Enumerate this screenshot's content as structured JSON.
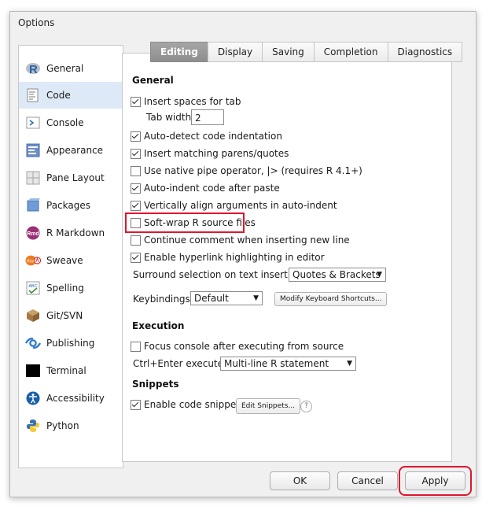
{
  "window": {
    "title": "Options"
  },
  "sidebar": {
    "items": [
      {
        "label": "General",
        "icon": "r-logo-icon"
      },
      {
        "label": "Code",
        "icon": "code-icon"
      },
      {
        "label": "Console",
        "icon": "console-icon"
      },
      {
        "label": "Appearance",
        "icon": "appearance-icon"
      },
      {
        "label": "Pane Layout",
        "icon": "pane-layout-icon"
      },
      {
        "label": "Packages",
        "icon": "packages-icon"
      },
      {
        "label": "R Markdown",
        "icon": "rmarkdown-icon"
      },
      {
        "label": "Sweave",
        "icon": "sweave-icon"
      },
      {
        "label": "Spelling",
        "icon": "spelling-icon"
      },
      {
        "label": "Git/SVN",
        "icon": "git-svn-icon"
      },
      {
        "label": "Publishing",
        "icon": "publishing-icon"
      },
      {
        "label": "Terminal",
        "icon": "terminal-icon"
      },
      {
        "label": "Accessibility",
        "icon": "accessibility-icon"
      },
      {
        "label": "Python",
        "icon": "python-icon"
      }
    ],
    "active": "Code",
    "icon_labels": {
      "rmarkdown": "Rmd",
      "sweave": "Rnw",
      "spelling": "ABC"
    }
  },
  "tabs": [
    "Editing",
    "Display",
    "Saving",
    "Completion",
    "Diagnostics"
  ],
  "active_tab": "Editing",
  "general": {
    "heading": "General",
    "insert_spaces": {
      "label": "Insert spaces for tab",
      "checked": true
    },
    "tab_width": {
      "label": "Tab width",
      "value": "2"
    },
    "auto_detect": {
      "label": "Auto-detect code indentation",
      "checked": true
    },
    "matching_parens": {
      "label": "Insert matching parens/quotes",
      "checked": true
    },
    "native_pipe": {
      "label": "Use native pipe operator, |> (requires R 4.1+)",
      "checked": false
    },
    "auto_indent": {
      "label": "Auto-indent code after paste",
      "checked": true
    },
    "vertical_align": {
      "label": "Vertically align arguments in auto-indent",
      "checked": true
    },
    "soft_wrap": {
      "label": "Soft-wrap R source files",
      "checked": false
    },
    "continue_comment": {
      "label": "Continue comment when inserting new line",
      "checked": false
    },
    "hyperlink": {
      "label": "Enable hyperlink highlighting in editor",
      "checked": true
    },
    "surround": {
      "label": "Surround selection on text insertion:",
      "value": "Quotes & Brackets"
    },
    "keybindings": {
      "label": "Keybindings:",
      "value": "Default"
    },
    "modify_shortcuts": "Modify Keyboard Shortcuts..."
  },
  "execution": {
    "heading": "Execution",
    "focus_console": {
      "label": "Focus console after executing from source",
      "checked": false
    },
    "ctrl_enter": {
      "label": "Ctrl+Enter executes:",
      "value": "Multi-line R statement"
    }
  },
  "snippets": {
    "heading": "Snippets",
    "enable": {
      "label": "Enable code snippets",
      "checked": true
    },
    "edit_button": "Edit Snippets...",
    "help": "?"
  },
  "buttons": {
    "ok": "OK",
    "cancel": "Cancel",
    "apply": "Apply"
  },
  "colors": {
    "highlight": "#e0152b",
    "selected_bg": "#dde9f6",
    "tab_active": "#9a9a9a"
  }
}
